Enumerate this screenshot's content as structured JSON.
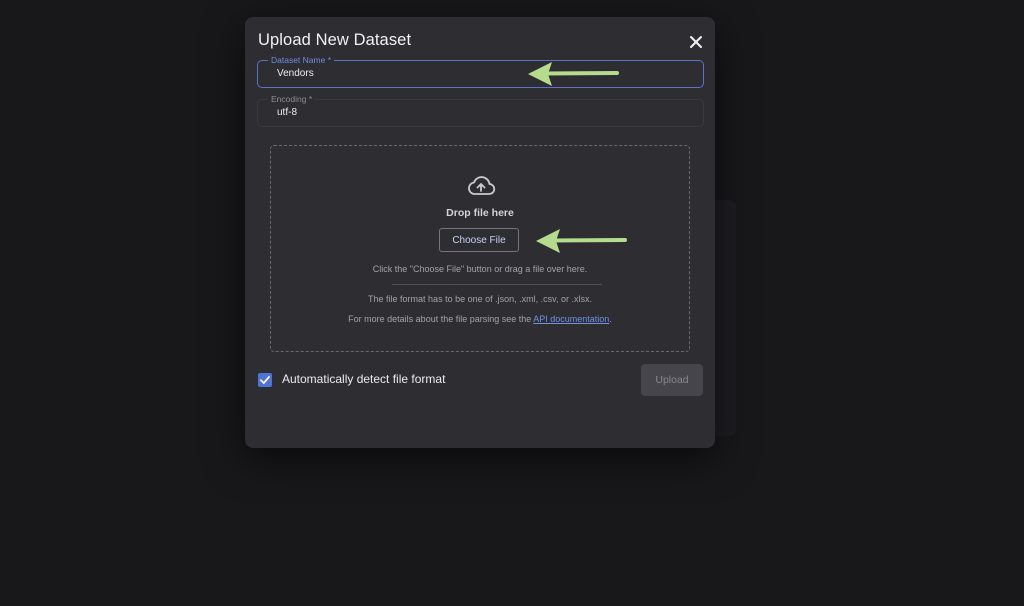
{
  "dialog": {
    "title": "Upload New Dataset"
  },
  "dataset_name": {
    "label": "Dataset Name",
    "required_mark": "*",
    "value": "Vendors"
  },
  "encoding": {
    "label": "Encoding",
    "required_mark": "*",
    "value": "utf-8"
  },
  "dropzone": {
    "icon": "cloud-upload-icon",
    "title": "Drop file here",
    "choose_button": "Choose File",
    "hint": "Click the \"Choose File\" button or drag a file over here.",
    "format_note": "The file format has to be one of .json, .xml, .csv, or .xlsx.",
    "details_prefix": "For more details about the file parsing see the ",
    "details_link": "API documentation",
    "details_suffix": "."
  },
  "auto_detect": {
    "label": "Automatically detect file format",
    "checked": true
  },
  "upload_button": "Upload",
  "colors": {
    "accent": "#4f74d8",
    "annotation_arrow": "#b5dc8c",
    "modal_bg": "#2e2d32",
    "page_bg": "#18181b"
  }
}
